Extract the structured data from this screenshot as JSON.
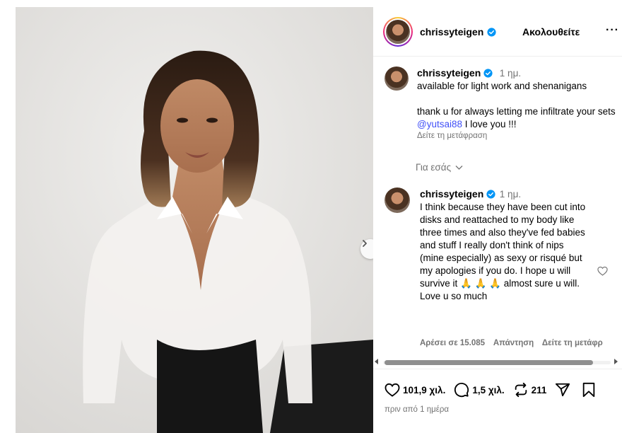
{
  "post": {
    "username": "chrissyteigen",
    "follow_label": "Ακολουθείτε",
    "more_label": "···"
  },
  "caption": {
    "username": "chrissyteigen",
    "time": "1 ημ.",
    "line1": "available for light work and shenanigans",
    "line2": "thank u for always letting me infiltrate your sets",
    "mention": "@yutsai88",
    "line2_end": "I love you !!!",
    "translate": "Δείτε τη μετάφραση"
  },
  "for_you": {
    "label": "Για εσάς"
  },
  "comment": {
    "username": "chrissyteigen",
    "time": "1 ημ.",
    "text": "I think because they have been cut into disks and reattached to my body like three times and also they've fed babies and stuff I really don't think of nips (mine especially) as sexy or risqué but my apologies if you do. I hope u will survive it",
    "emoji_1": "🙏",
    "emoji_2": "🙏 🙏",
    "text_end": "almost sure u will. Love u so much",
    "likes_label": "Αρέσει σε 15.085",
    "reply_label": "Απάντηση",
    "translate_label": "Δείτε τη μετάφρ"
  },
  "stats": {
    "likes": "101,9 χιλ.",
    "comments": "1,5 χιλ.",
    "reposts": "211"
  },
  "timestamp": "πριν από 1 ημέρα",
  "colors": {
    "link": "#4150f7",
    "secondary_text": "#737373",
    "verified": "#0095f6",
    "divider": "#efefef"
  },
  "icons": [
    "verified-icon",
    "more-icon",
    "chevron-down-icon",
    "heart-icon",
    "comment-icon",
    "repost-icon",
    "share-icon",
    "bookmark-icon",
    "chevron-right-icon",
    "scroll-left-icon",
    "scroll-right-icon"
  ]
}
